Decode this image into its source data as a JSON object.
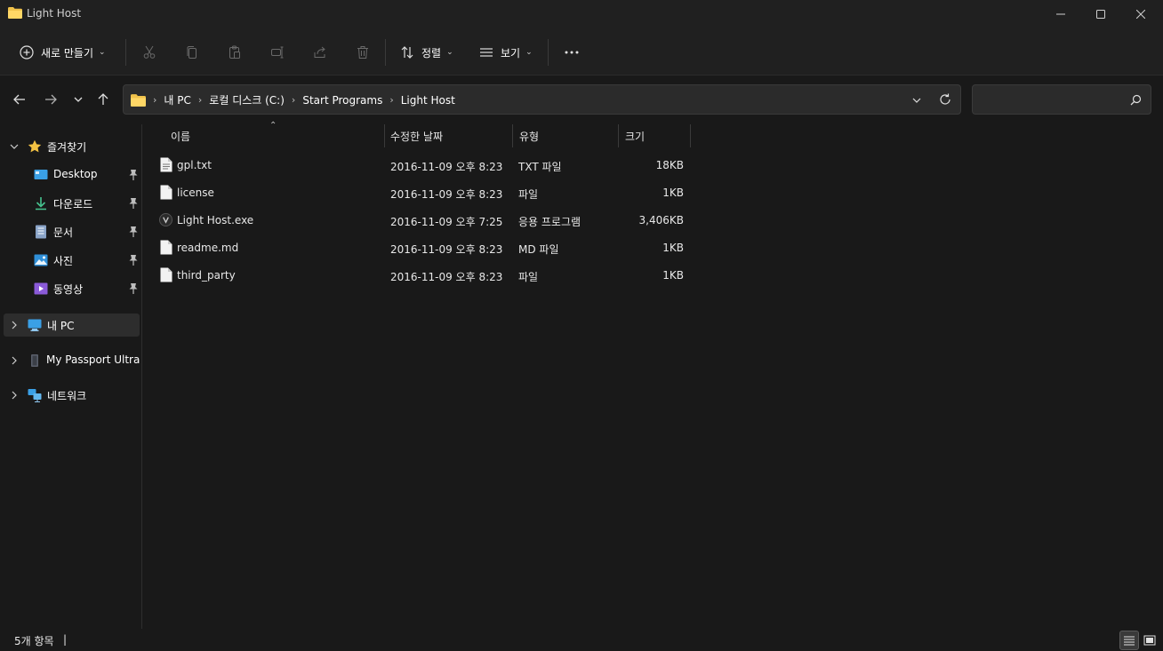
{
  "window": {
    "title": "Light Host"
  },
  "toolbar": {
    "new_label": "새로 만들기",
    "sort_label": "정렬",
    "view_label": "보기"
  },
  "address": {
    "crumbs": [
      "내 PC",
      "로컬 디스크 (C:)",
      "Start Programs",
      "Light Host"
    ]
  },
  "search": {
    "placeholder": ""
  },
  "sidebar": {
    "quick_access": "즐겨찾기",
    "items": [
      {
        "label": "Desktop",
        "icon": "desktop-icon"
      },
      {
        "label": "다운로드",
        "icon": "download-icon"
      },
      {
        "label": "문서",
        "icon": "document-icon"
      },
      {
        "label": "사진",
        "icon": "picture-icon"
      },
      {
        "label": "동영상",
        "icon": "video-icon"
      }
    ],
    "this_pc": "내 PC",
    "drive": "My Passport Ultra (I",
    "network": "네트워크"
  },
  "table": {
    "headers": {
      "name": "이름",
      "modified": "수정한 날짜",
      "type": "유형",
      "size": "크기"
    },
    "rows": [
      {
        "name": "gpl.txt",
        "modified": "2016-11-09 오후 8:23",
        "type": "TXT 파일",
        "size": "18KB",
        "icon": "text-file-icon"
      },
      {
        "name": "license",
        "modified": "2016-11-09 오후 8:23",
        "type": "파일",
        "size": "1KB",
        "icon": "file-icon"
      },
      {
        "name": "Light Host.exe",
        "modified": "2016-11-09 오후 7:25",
        "type": "응용 프로그램",
        "size": "3,406KB",
        "icon": "app-icon"
      },
      {
        "name": "readme.md",
        "modified": "2016-11-09 오후 8:23",
        "type": "MD 파일",
        "size": "1KB",
        "icon": "file-icon"
      },
      {
        "name": "third_party",
        "modified": "2016-11-09 오후 8:23",
        "type": "파일",
        "size": "1KB",
        "icon": "file-icon"
      }
    ]
  },
  "status": {
    "count": "5개 항목",
    "cursor": "|"
  },
  "colors": {
    "folder": "#f0c24b",
    "accent": "#4cc2ff"
  }
}
